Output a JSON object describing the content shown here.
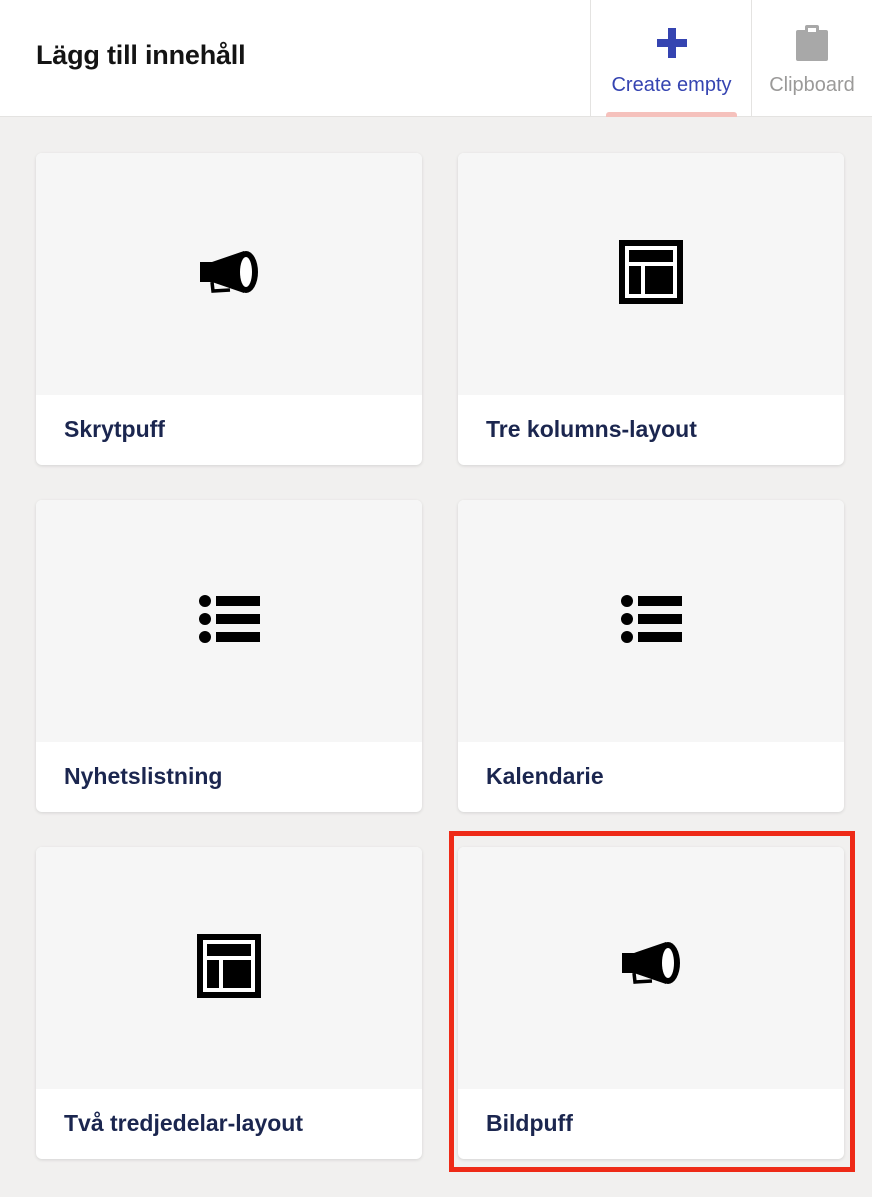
{
  "header": {
    "title": "Lägg till innehåll",
    "tabs": [
      {
        "label": "Create empty",
        "icon": "plus-icon",
        "active": true,
        "color": "#3544b1"
      },
      {
        "label": "Clipboard",
        "icon": "clipboard-icon",
        "active": false,
        "color": "#9b9a99"
      }
    ]
  },
  "cards": [
    {
      "label": "Skrytpuff",
      "icon": "megaphone-icon"
    },
    {
      "label": "Tre kolumns-layout",
      "icon": "layout-icon"
    },
    {
      "label": "Nyhetslistning",
      "icon": "list-icon"
    },
    {
      "label": "Kalendarie",
      "icon": "list-icon"
    },
    {
      "label": "Två tredjedelar-layout",
      "icon": "layout-icon"
    },
    {
      "label": "Bildpuff",
      "icon": "megaphone-icon",
      "highlighted": true
    }
  ],
  "colors": {
    "accent": "#3544b1",
    "highlight": "#ee2a17",
    "card_title": "#1b264f",
    "background": "#f1f0ef"
  }
}
